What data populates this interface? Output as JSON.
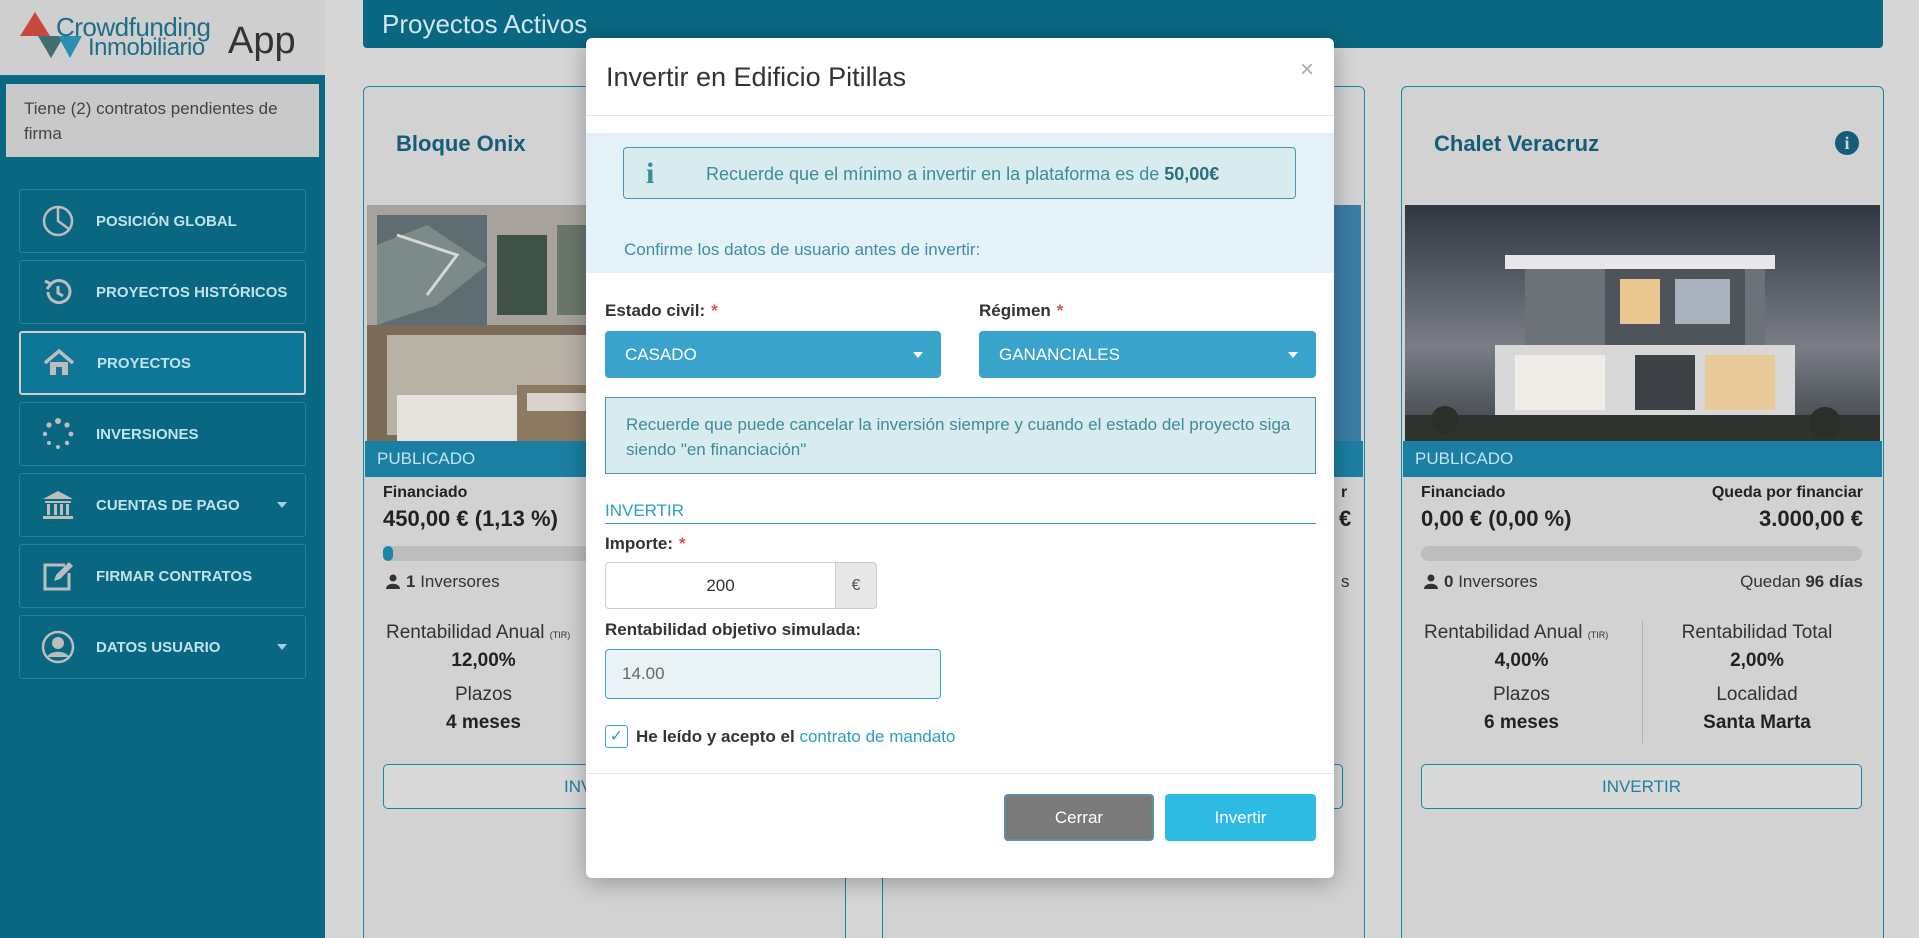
{
  "app": {
    "logo_line1": "Crowdfunding",
    "logo_line2": "Inmobiliario",
    "logo_app": "App"
  },
  "sidebar": {
    "pending_text": "Tiene (2) contratos pendientes de firma",
    "items": [
      {
        "label": "POSICIÓN GLOBAL",
        "icon": "pie-chart-icon"
      },
      {
        "label": "PROYECTOS HISTÓRICOS",
        "icon": "history-icon"
      },
      {
        "label": "PROYECTOS",
        "icon": "home-icon",
        "active": true
      },
      {
        "label": "INVERSIONES",
        "icon": "spinner-icon"
      },
      {
        "label": "CUENTAS DE PAGO",
        "icon": "bank-icon",
        "has_caret": true
      },
      {
        "label": "FIRMAR CONTRATOS",
        "icon": "edit-icon"
      },
      {
        "label": "DATOS USUARIO",
        "icon": "user-circle-icon",
        "has_caret": true
      }
    ]
  },
  "main": {
    "title": "Proyectos Activos",
    "cards": [
      {
        "title": "Bloque Onix",
        "status": "PUBLICADO",
        "financed_label": "Financiado",
        "financed_value": "450,00 € (1,13 %)",
        "investors_count": "1",
        "investors_label": "Inversores",
        "rent_anual_label": "Rentabilidad Anual",
        "tir": "(TIR)",
        "rent_anual_value": "12,00%",
        "plazos_label": "Plazos",
        "plazos_value": "4 meses",
        "button": "INVERTIR",
        "progress": 0.0113
      },
      {
        "title": "Chalet Veracruz",
        "status": "PUBLICADO",
        "financed_label": "Financiado",
        "financed_value": "0,00 € (0,00 %)",
        "remaining_label": "Queda por financiar",
        "remaining_value": "3.000,00 €",
        "investors_count": "0",
        "investors_label": "Inversores",
        "days_prefix": "Quedan",
        "days_value": "96 días",
        "rent_anual_label": "Rentabilidad Anual",
        "tir": "(TIR)",
        "rent_anual_value": "4,00%",
        "rent_total_label": "Rentabilidad Total",
        "rent_total_value": "2,00%",
        "plazos_label": "Plazos",
        "plazos_value": "6 meses",
        "localidad_label": "Localidad",
        "localidad_value": "Santa Marta",
        "button": "INVERTIR",
        "progress": 0
      }
    ],
    "middle_card_fragments": {
      "r_fragment": "r",
      "e_fragment": "€",
      "s_fragment": "s"
    }
  },
  "modal": {
    "title": "Invertir en Edificio Pitillas",
    "close_symbol": "×",
    "min_notice_prefix": "Recuerde que el mínimo a invertir en la plataforma es de ",
    "min_notice_amount": "50,00€",
    "confirm_text": "Confirme los datos de usuario antes de invertir:",
    "estado_civil_label": "Estado civil:",
    "estado_civil_value": "CASADO",
    "regimen_label": "Régimen",
    "regimen_value": "GANANCIALES",
    "required_mark": "*",
    "cancel_notice": "Recuerde que puede cancelar la inversión siempre y cuando el estado del proyecto siga siendo \"en financiación\"",
    "section_title": "INVERTIR",
    "importe_label": "Importe:",
    "importe_value": "200",
    "currency": "€",
    "rent_sim_label": "Rentabilidad objetivo simulada:",
    "rent_sim_value": "14.00",
    "accept_prefix": "He leído y acepto el ",
    "accept_link": "contrato de mandato",
    "accept_checked": true,
    "btn_close": "Cerrar",
    "btn_invest": "Invertir"
  }
}
